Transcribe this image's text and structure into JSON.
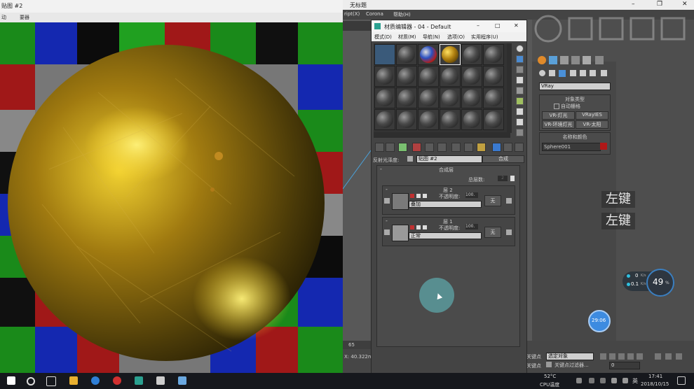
{
  "render_window": {
    "title": "贴图 #2",
    "menu": [
      "动",
      "要器"
    ]
  },
  "max": {
    "title": "无标题",
    "window_controls": [
      "–",
      "❐",
      "✕"
    ],
    "menu": [
      "ript(X)",
      "Corona",
      "帮助(H)"
    ]
  },
  "mat_editor": {
    "title": "材质编辑器 - 04 - Default",
    "controls": [
      "–",
      "□",
      "✕"
    ],
    "menu": [
      "模式(D)",
      "材质(M)",
      "导航(N)",
      "选项(O)",
      "实用程序(U)"
    ],
    "reflect_label": "反射光泽度:",
    "map_name": "贴图 #2",
    "map_type": "合成",
    "composite_rollout_title": "合成层",
    "total_layers_label": "总层数:",
    "total_layers_value": "2",
    "layers": [
      {
        "title": "层 2",
        "opacity_label": "不透明度:",
        "opacity_value": "100.",
        "blend_mode": "叠加",
        "none_label": "无"
      },
      {
        "title": "层 1",
        "opacity_label": "不透明度:",
        "opacity_value": "100.",
        "blend_mode": "正常",
        "none_label": "无"
      }
    ]
  },
  "command_panel": {
    "renderer_dropdown": "VRay",
    "object_type_title": "对象类型",
    "autogrid": "自动栅格",
    "buttons": [
      "VR-灯光",
      "VRayIES",
      "VR-环境灯光",
      "VR-太阳"
    ],
    "name_color_title": "名称和颜色",
    "object_name": "Sphere001",
    "object_color": "#b01818"
  },
  "overlay": {
    "key_hint_1": "左键",
    "key_hint_2": "左键",
    "net_up": "0",
    "net_up_unit": "K/s",
    "net_down": "0.1",
    "net_down_unit": "K/s",
    "cpu_percent": "49",
    "cpu_unit": "%",
    "timer": "29:06"
  },
  "bottom": {
    "frame_number": "65",
    "coord": "X: 40.322mm",
    "key_label_1": "关键点",
    "selection_dropdown": "选定对象",
    "key_label_2": "关键点",
    "key_filter": "关键点过滤器...",
    "frame_field": "0"
  },
  "taskbar": {
    "temp": "52°C",
    "temp_label": "CPU温度",
    "ime": "英",
    "time": "17:41",
    "date": "2018/10/15"
  },
  "colors": {
    "accent_blue": "#2f7fd6",
    "timer_blue": "#3d8be0",
    "cursor_circle": "#5a9a9c"
  }
}
